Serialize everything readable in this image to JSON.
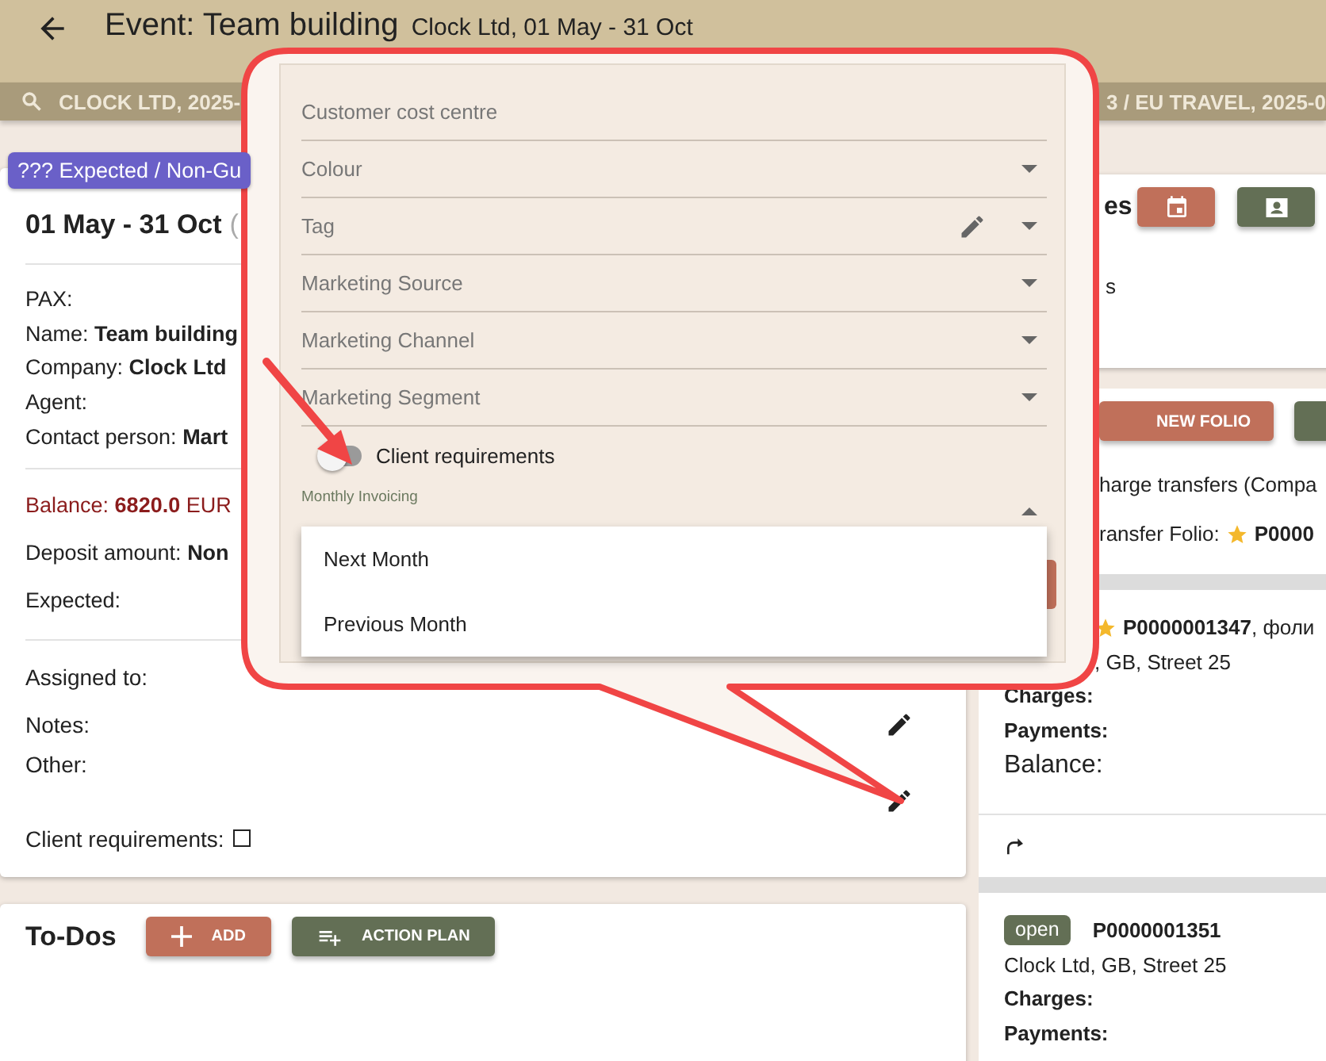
{
  "header": {
    "title": "Event: Team building",
    "subtitle": "Clock Ltd, 01 May - 31 Oct"
  },
  "breadcrumb": {
    "left": "CLOCK LTD, 2025-",
    "right": "3 / EU TRAVEL, 2025-0"
  },
  "event_card": {
    "status_badge": "??? Expected / Non-Gu",
    "dates": "01 May - 31 Oct",
    "dates_suffix": "(",
    "info": [
      "PAX:",
      "Name: **Team building**",
      "Company: **Clock Ltd**",
      "Agent:",
      "Contact person: **Mart**"
    ],
    "money": [
      {
        "text": "Balance: **6820.0** EUR",
        "kind": "balance"
      },
      {
        "text": "Deposit amount: **Non**",
        "kind": "line"
      },
      {
        "text": "Expected:",
        "kind": "line"
      }
    ],
    "extra": [
      {
        "label": "Assigned to:",
        "editable": false
      },
      {
        "label": "Notes:",
        "editable": true
      },
      {
        "label": "Other:",
        "editable": true
      }
    ],
    "client_requirements": {
      "label": "Client requirements:",
      "checked": false
    }
  },
  "todos": {
    "title": "To-Dos",
    "buttons": [
      {
        "label": "ADD",
        "kind": "add"
      },
      {
        "label": "ACTION PLAN",
        "kind": "plan"
      }
    ]
  },
  "side_card": {
    "title": "es",
    "text": "s"
  },
  "folio_actions": {
    "new_folio": "NEW FOLIO",
    "note": "harge transfers (Compa",
    "transfer_label": "ransfer Folio:",
    "transfer_id": "P0000"
  },
  "folios": [
    {
      "starred": true,
      "id": "P0000001347",
      "suffix": ", фоли",
      "address": ", GB, Street 25",
      "lines": [
        "Charges:",
        "Payments:"
      ],
      "balance": "Balance:"
    },
    {
      "status": "open",
      "starred": false,
      "id": "P0000001351",
      "address": "Clock Ltd, GB, Street 25",
      "lines": [
        "Charges:",
        "Payments:"
      ]
    }
  ],
  "callout": {
    "fields": [
      {
        "label": "Customer cost centre",
        "kind": "text",
        "editable": false
      },
      {
        "label": "Colour",
        "kind": "select",
        "editable": false
      },
      {
        "label": "Tag",
        "kind": "select",
        "editable": true
      },
      {
        "label": "Marketing Source",
        "kind": "select",
        "editable": false
      },
      {
        "label": "Marketing Channel",
        "kind": "select",
        "editable": false
      },
      {
        "label": "Marketing Segment",
        "kind": "select",
        "editable": false
      }
    ],
    "toggle": {
      "label": "Client requirements",
      "on": false
    },
    "open_select": {
      "label": "Monthly Invoicing",
      "expanded": true,
      "options": [
        "Next Month",
        "Previous Month"
      ]
    }
  }
}
